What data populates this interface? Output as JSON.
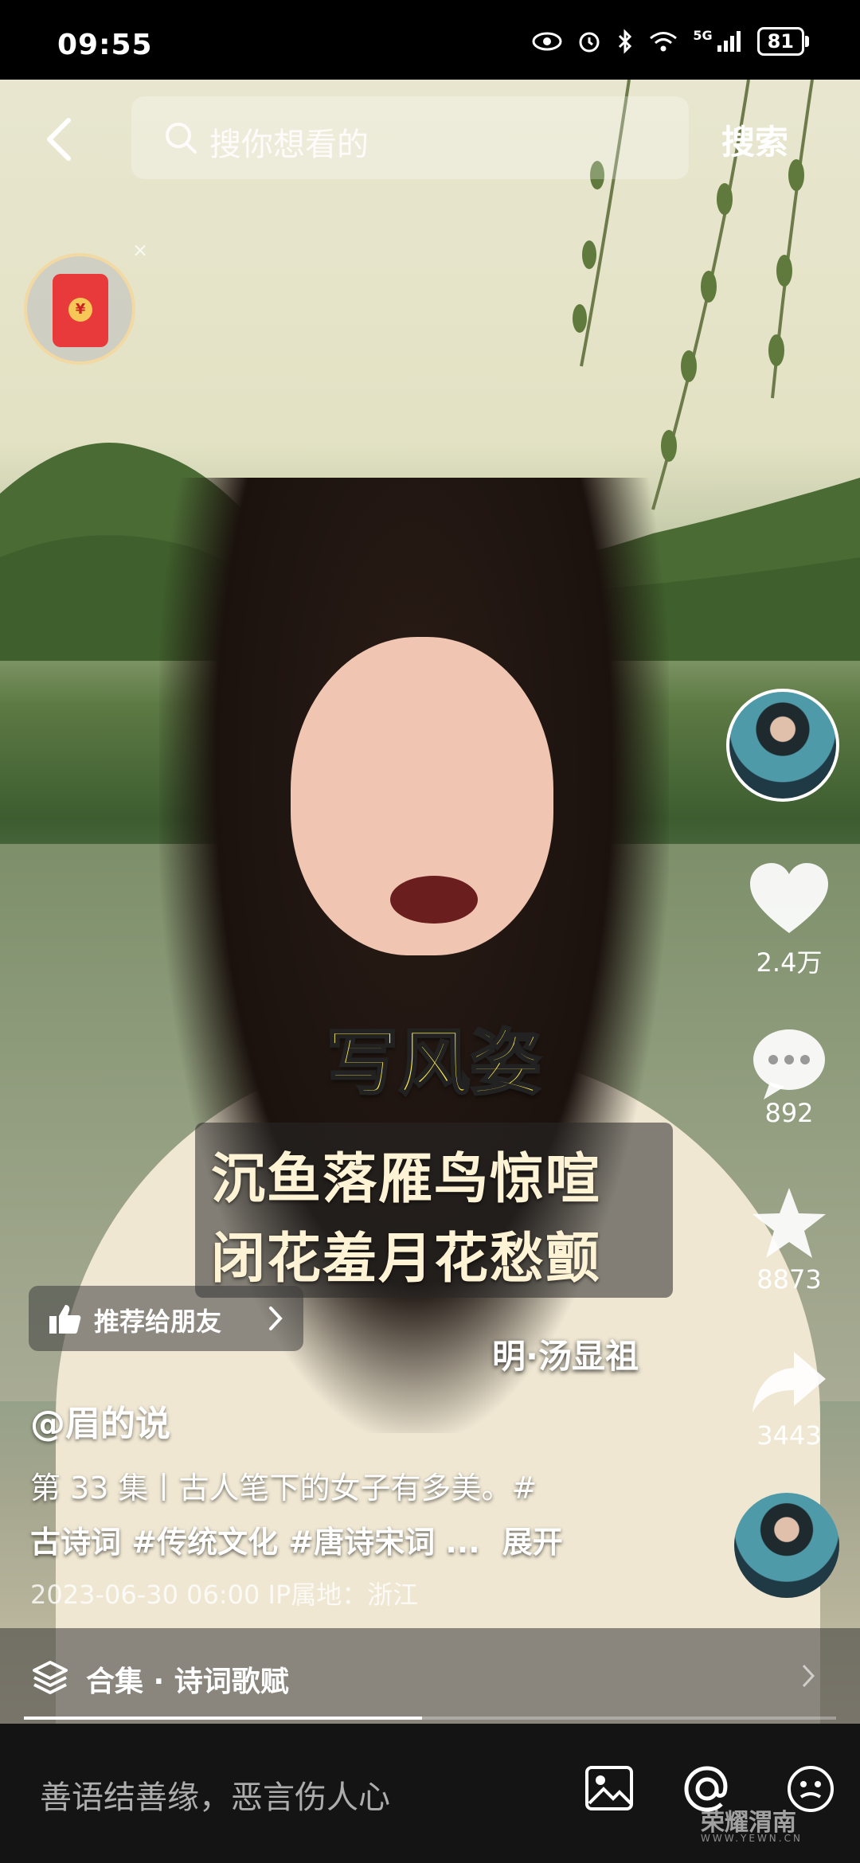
{
  "status_bar": {
    "time": "09:55",
    "network": "5G",
    "battery": "81"
  },
  "topbar": {
    "search_placeholder": "搜你想看的",
    "search_button": "搜索"
  },
  "red_packet": {
    "symbol": "¥",
    "close": "×"
  },
  "side_actions": {
    "likes": "2.4万",
    "comments": "892",
    "favorites": "8873",
    "shares": "3443"
  },
  "video": {
    "caption_top": "写风姿",
    "caption_line1": "沉鱼落雁鸟惊喧",
    "caption_line2": "闭花羞月花愁颤",
    "caption_author": "明·汤显祖",
    "progress_fraction": 0.49
  },
  "recommend": {
    "label": "推荐给朋友"
  },
  "post": {
    "author": "@眉的说",
    "desc_line1": "第 33 集丨古人笔下的女子有多美。#",
    "desc_line2_tags": "古诗词 #传统文化 #唐诗宋词 ...",
    "expand": "展开",
    "meta": "2023-06-30 06:00  IP属地：浙江"
  },
  "collection": {
    "label": "合集 · 诗词歌赋"
  },
  "bottom_bar": {
    "comment_placeholder": "善语结善缘，恶言伤人心"
  },
  "watermark": {
    "text": "荣耀渭南",
    "sub": "WWW.YEWN.CN"
  },
  "colors": {
    "caption_yellow": "#ffe94d",
    "red_packet": "#e83a3a"
  }
}
